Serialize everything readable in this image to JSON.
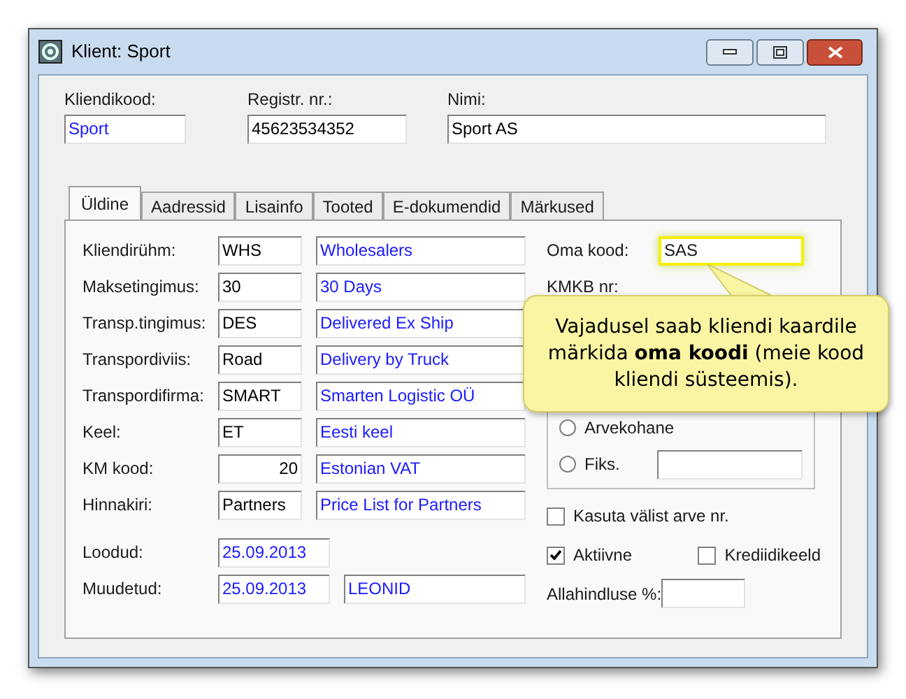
{
  "window": {
    "title": "Klient: Sport"
  },
  "header": [
    {
      "label": "Kliendikood:",
      "value": "Sport",
      "kind": "lookup"
    },
    {
      "label": "Registr. nr.:",
      "value": "45623534352",
      "kind": "input"
    },
    {
      "label": "Nimi:",
      "value": "Sport AS",
      "kind": "input"
    }
  ],
  "tabs": [
    {
      "label": "Üldine",
      "selected": true
    },
    {
      "label": "Aadressid",
      "selected": false
    },
    {
      "label": "Lisainfo",
      "selected": false
    },
    {
      "label": "Tooted",
      "selected": false
    },
    {
      "label": "E-dokumendid",
      "selected": false
    },
    {
      "label": "Märkused",
      "selected": false
    }
  ],
  "rows": [
    {
      "label": "Kliendirühm:",
      "fields": [
        {
          "value": "WHS",
          "kind": "input"
        },
        {
          "value": "Wholesalers",
          "kind": "lookup"
        }
      ]
    },
    {
      "label": "Maksetingimus:",
      "fields": [
        {
          "value": "30",
          "kind": "input"
        },
        {
          "value": "30 Days",
          "kind": "lookup"
        }
      ]
    },
    {
      "label": "Transp.tingimus:",
      "fields": [
        {
          "value": "DES",
          "kind": "input"
        },
        {
          "value": "Delivered Ex Ship",
          "kind": "lookup"
        }
      ]
    },
    {
      "label": "Transpordiviis:",
      "fields": [
        {
          "value": "Road",
          "kind": "input"
        },
        {
          "value": "Delivery by Truck",
          "kind": "lookup"
        }
      ]
    },
    {
      "label": "Transpordifirma:",
      "fields": [
        {
          "value": "SMART",
          "kind": "input"
        },
        {
          "value": "Smarten Logistic OÜ",
          "kind": "lookup"
        }
      ]
    },
    {
      "label": "Keel:",
      "fields": [
        {
          "value": "ET",
          "kind": "input"
        },
        {
          "value": "Eesti keel",
          "kind": "lookup"
        }
      ]
    },
    {
      "label": "KM kood:",
      "fields": [
        {
          "value": "20",
          "kind": "number"
        },
        {
          "value": "Estonian VAT",
          "kind": "lookup"
        }
      ]
    },
    {
      "label": "Hinnakiri:",
      "fields": [
        {
          "value": "Partners",
          "kind": "input"
        },
        {
          "value": "Price List for Partners",
          "kind": "lookup"
        }
      ]
    }
  ],
  "dates": [
    {
      "label": "Loodud:",
      "fields": [
        {
          "value": "25.09.2013",
          "kind": "lookup"
        }
      ]
    },
    {
      "label": "Muudetud:",
      "fields": [
        {
          "value": "25.09.2013",
          "kind": "lookup"
        },
        {
          "value": "LEONID",
          "kind": "lookup"
        }
      ]
    }
  ],
  "own_code": {
    "label": "Oma kood:",
    "value": "SAS"
  },
  "kmkb": {
    "label": "KMKB nr:"
  },
  "radios": [
    {
      "label": "Arvekohane",
      "selected": false,
      "kind": "plain"
    },
    {
      "label": "Fiks.",
      "selected": false,
      "kind": "with_field"
    }
  ],
  "checkboxes": [
    {
      "label": "Kasuta välist arve nr.",
      "checked": false
    },
    {
      "label": "Aktiivne",
      "checked": true
    },
    {
      "label": "Krediidikeeld",
      "checked": false
    }
  ],
  "discount": {
    "label": "Allahindluse %:"
  },
  "callout": {
    "text": "Vajadusel saab kliendi kaardile märkida **oma koodi** (meie kood kliendi süsteemis)."
  }
}
